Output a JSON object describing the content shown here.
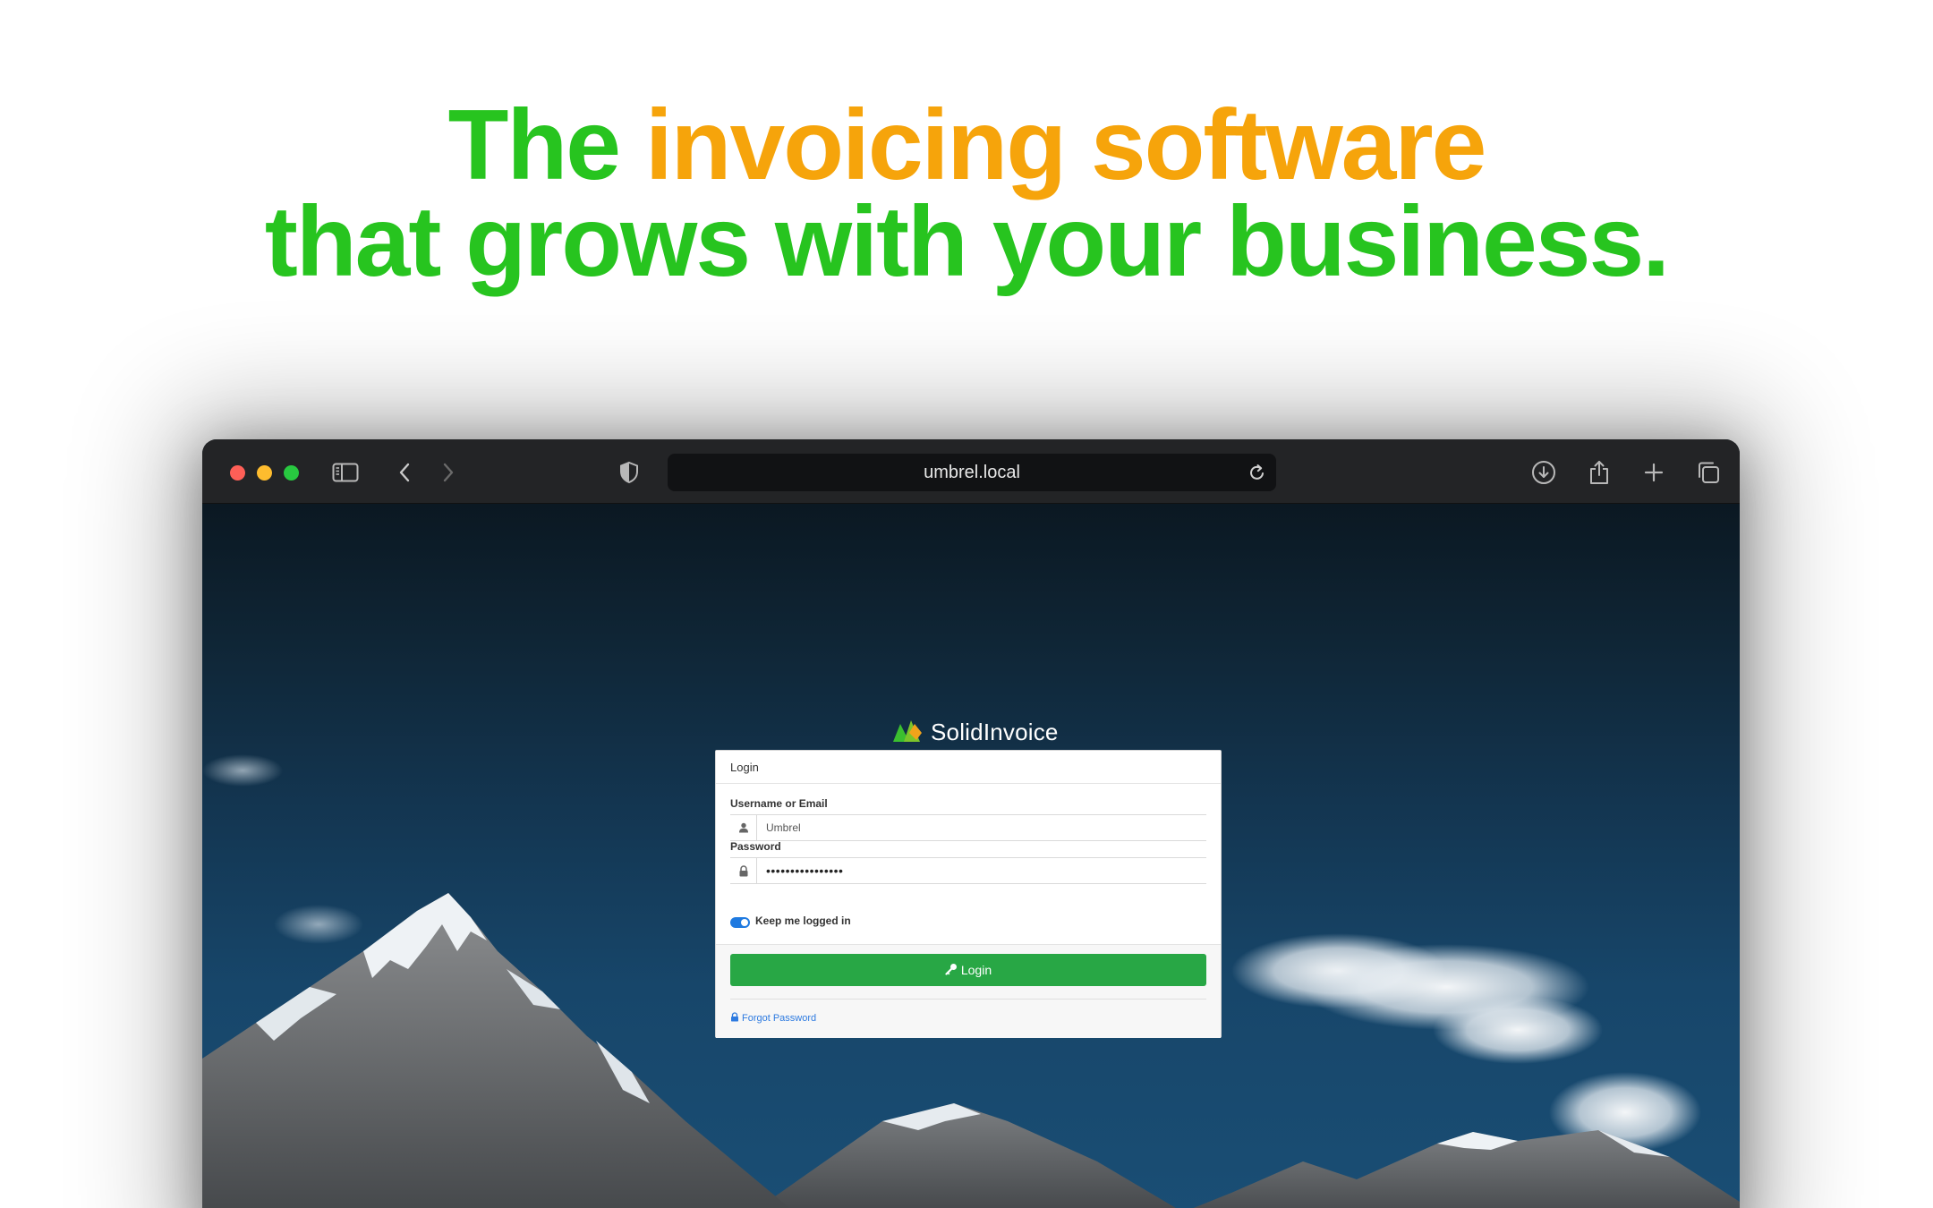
{
  "headline": {
    "line1_prefix": "The",
    "line1_accent": "invoicing software",
    "line2": "that grows with your business."
  },
  "colors": {
    "headline_green": "#27c41f",
    "headline_orange": "#f6a40b",
    "login_button": "#28a745",
    "link_blue": "#2d7ae0"
  },
  "browser": {
    "url": "umbrel.local",
    "toolbar_icons": [
      "sidebar-icon",
      "back-icon",
      "forward-icon",
      "shield-icon",
      "reload-icon",
      "download-icon",
      "share-icon",
      "new-tab-icon",
      "tabs-overview-icon"
    ]
  },
  "app": {
    "brand_name": "SolidInvoice",
    "login_card": {
      "header": "Login",
      "username_label": "Username or Email",
      "username_value": "Umbrel",
      "password_label": "Password",
      "password_value": "••••••••••••••••",
      "keep_logged_in_label": "Keep me logged in",
      "keep_logged_in": true,
      "login_button": "Login",
      "forgot_password": "Forgot Password"
    }
  }
}
